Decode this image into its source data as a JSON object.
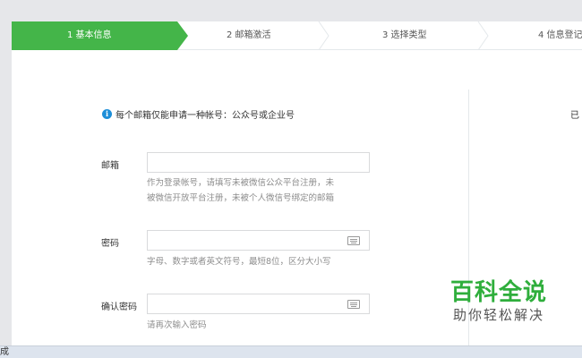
{
  "steps": [
    {
      "label": "1 基本信息",
      "active": true
    },
    {
      "label": "2 邮箱激活",
      "active": false
    },
    {
      "label": "3 选择类型",
      "active": false
    },
    {
      "label": "4 信息登记",
      "active": false
    }
  ],
  "notice": {
    "icon": "info-icon",
    "text": "每个邮箱仅能申请一种帐号：公众号或企业号"
  },
  "form": {
    "email": {
      "label": "邮箱",
      "value": "",
      "hint_line1": "作为登录帐号，请填写未被微信公众平台注册，未",
      "hint_line2": "被微信开放平台注册，未被个人微信号绑定的邮箱"
    },
    "password": {
      "label": "密码",
      "value": "",
      "hint": "字母、数字或者英文符号，最短8位，区分大小写"
    },
    "confirm_password": {
      "label": "确认密码",
      "value": "",
      "hint": "请再次输入密码"
    }
  },
  "side": {
    "text": "已"
  },
  "watermark": {
    "title": "百科全说",
    "subtitle": "助你轻松解决"
  },
  "status_bar": {
    "text": "成"
  },
  "colors": {
    "accent": "#44b549",
    "watermark": "#2fae3c",
    "info": "#1d8ed8"
  }
}
